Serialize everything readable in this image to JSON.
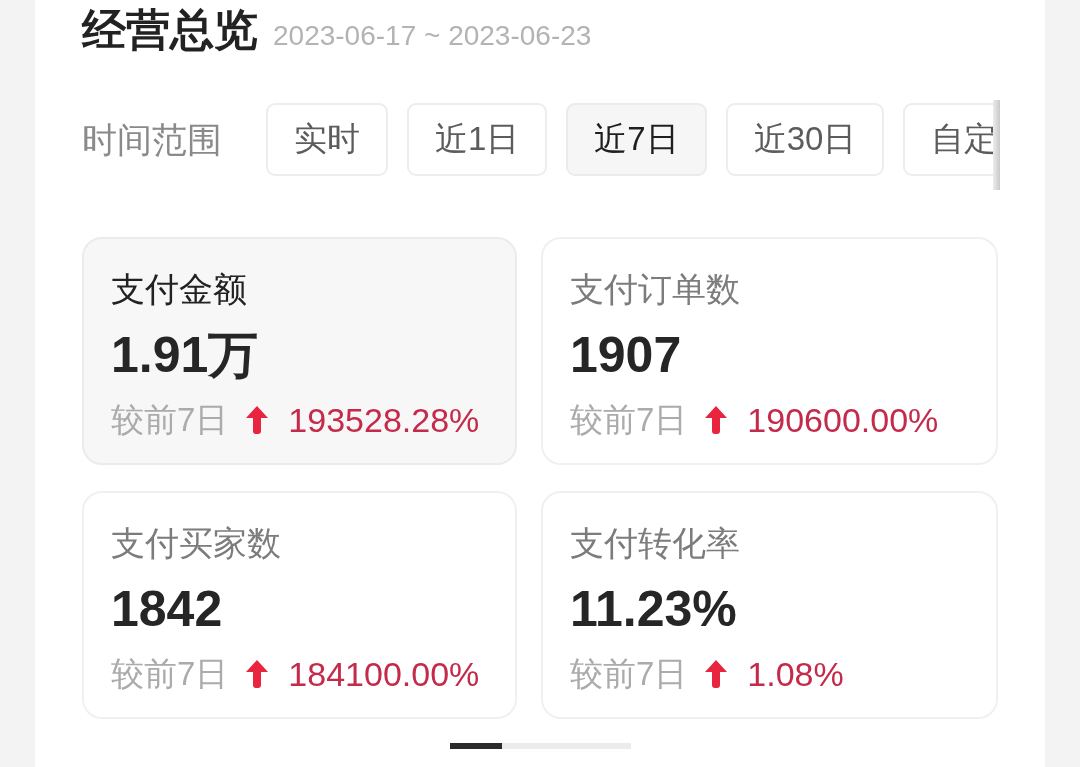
{
  "header": {
    "title": "经营总览",
    "date_range": "2023-06-17 ~ 2023-06-23"
  },
  "time_range": {
    "label": "时间范围",
    "options": [
      {
        "label": "实时",
        "selected": false
      },
      {
        "label": "近1日",
        "selected": false
      },
      {
        "label": "近7日",
        "selected": true
      },
      {
        "label": "近30日",
        "selected": false
      },
      {
        "label": "自定",
        "selected": false
      }
    ]
  },
  "metrics": [
    {
      "name": "支付金额",
      "value": "1.91万",
      "comparison_label": "较前7日",
      "rising": true,
      "change": "193528.28%",
      "selected": true
    },
    {
      "name": "支付订单数",
      "value": "1907",
      "comparison_label": "较前7日",
      "rising": true,
      "change": "190600.00%",
      "selected": false
    },
    {
      "name": "支付买家数",
      "value": "1842",
      "comparison_label": "较前7日",
      "rising": true,
      "change": "184100.00%",
      "selected": false
    },
    {
      "name": "支付转化率",
      "value": "11.23%",
      "comparison_label": "较前7日",
      "rising": true,
      "change": "1.08%",
      "selected": false
    }
  ]
}
